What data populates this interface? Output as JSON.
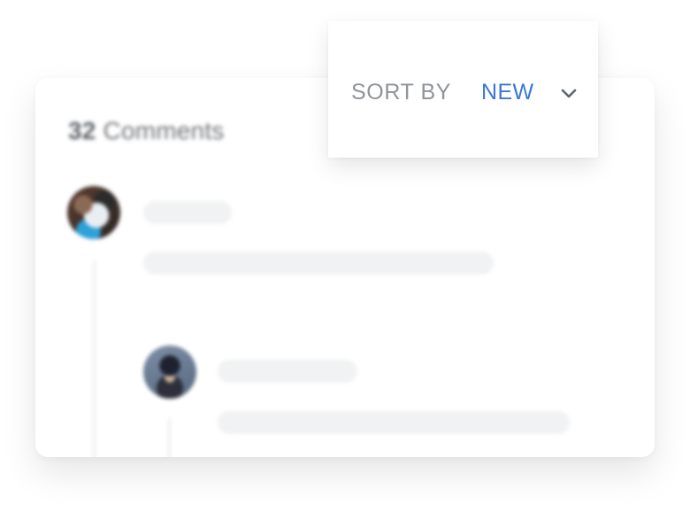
{
  "comments": {
    "count": "32",
    "label": "Comments"
  },
  "sort": {
    "label": "SORT BY",
    "selected": "NEW"
  },
  "colors": {
    "accent": "#3a78d4",
    "muted_text": "#8f949a",
    "skeleton": "#f1f2f3"
  },
  "icons": {
    "sort_toggle": "chevron-down-icon"
  }
}
